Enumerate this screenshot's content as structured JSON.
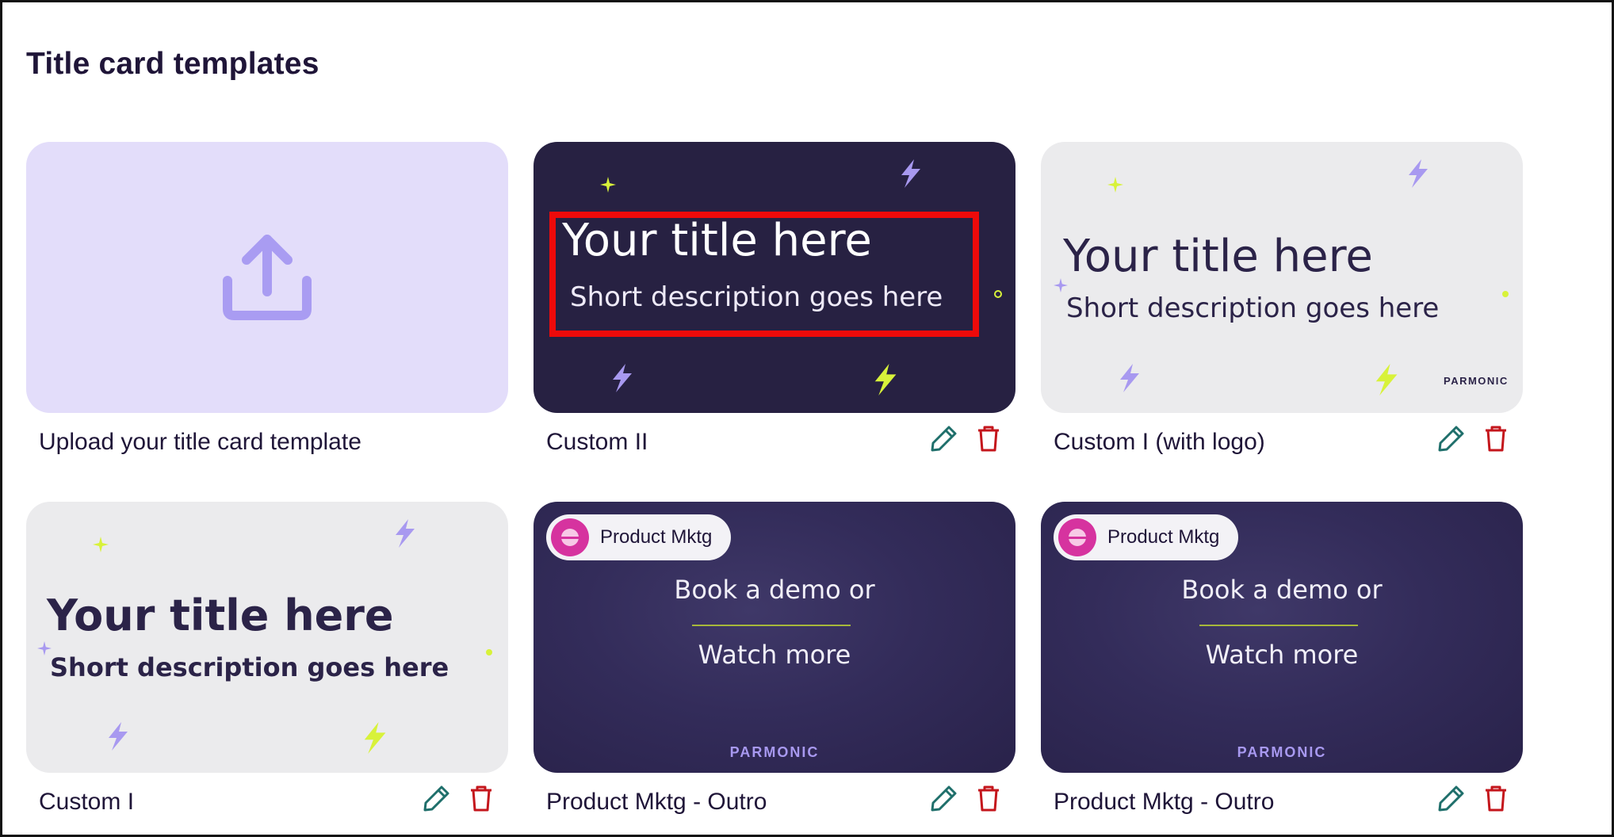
{
  "page": {
    "title": "Title card templates"
  },
  "upload_card": {
    "label": "Upload your title card template",
    "icon": "upload-icon"
  },
  "templates": [
    {
      "label": "Custom II",
      "title": "Your title here",
      "description": "Short description goes here",
      "style": "dark"
    },
    {
      "label": "Custom I (with logo)",
      "title": "Your title here",
      "description": "Short description goes here",
      "brand": "PARMONIC",
      "style": "light"
    },
    {
      "label": "Custom I",
      "title": "Your title here",
      "description": "Short description goes here",
      "style": "light-bold"
    },
    {
      "label": "Product Mktg - Outro",
      "badge": "Product Mktg",
      "line1": "Book a demo or",
      "line2": "Watch more",
      "brand": "PARMONIC",
      "style": "outro"
    },
    {
      "label": "Product Mktg - Outro",
      "badge": "Product Mktg",
      "line1": "Book a demo or",
      "line2": "Watch more",
      "brand": "PARMONIC",
      "style": "outro"
    }
  ],
  "actions": {
    "edit_icon": "pencil-icon",
    "delete_icon": "trash-icon"
  },
  "colors": {
    "edit": "#1f6f6b",
    "delete": "#c4161c",
    "upload_bg": "#e3ddfa",
    "accent_purple": "#a899f0",
    "accent_lime": "#d8f23a",
    "highlight": "#ee0a0a"
  }
}
